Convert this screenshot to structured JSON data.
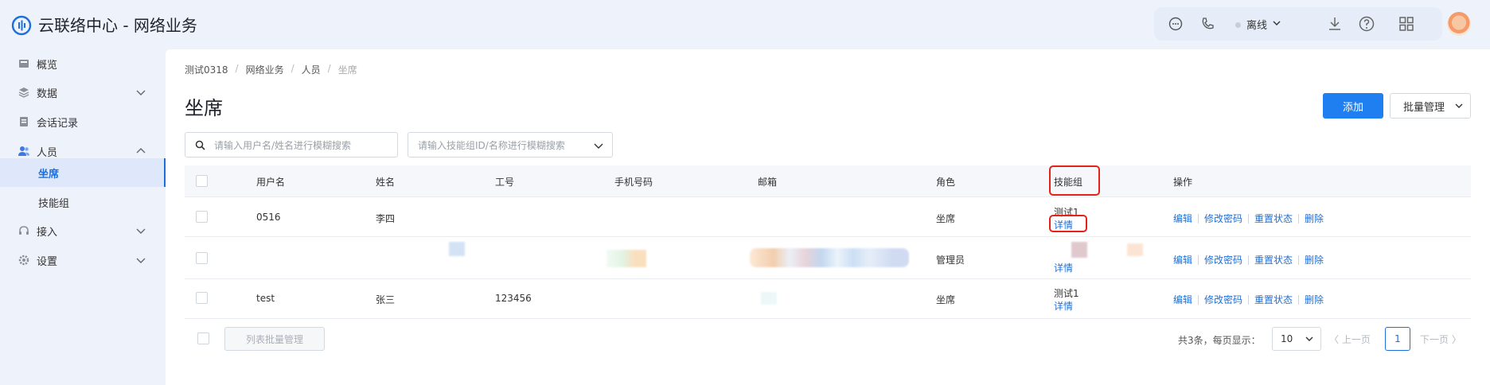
{
  "app": {
    "title": "云联络中心 - 网络业务"
  },
  "header": {
    "status_label": "离线"
  },
  "sidebar": {
    "items": [
      {
        "label": "概览"
      },
      {
        "label": "数据"
      },
      {
        "label": "会话记录"
      },
      {
        "label": "人员"
      },
      {
        "label": "坐席"
      },
      {
        "label": "技能组"
      },
      {
        "label": "接入"
      },
      {
        "label": "设置"
      }
    ]
  },
  "breadcrumb": [
    "测试0318",
    "网络业务",
    "人员",
    "坐席"
  ],
  "page": {
    "title": "坐席"
  },
  "toolbar": {
    "add_label": "添加",
    "batch_label": "批量管理"
  },
  "search": {
    "user_placeholder": "请输入用户名/姓名进行模糊搜索",
    "group_placeholder": "请输入技能组ID/名称进行模糊搜索"
  },
  "table": {
    "columns": [
      "用户名",
      "姓名",
      "工号",
      "手机号码",
      "邮箱",
      "角色",
      "技能组",
      "操作"
    ],
    "rows": [
      {
        "username": "0516",
        "name": "李四",
        "job_no": "",
        "phone": "",
        "email": "",
        "role": "坐席",
        "group": "测试1",
        "group_link": "详情"
      },
      {
        "username": "",
        "name": "",
        "job_no": "",
        "phone": "",
        "email": "",
        "role": "管理员",
        "group": "",
        "group_link": "详情"
      },
      {
        "username": "test",
        "name": "张三",
        "job_no": "123456",
        "phone": "",
        "email": "",
        "role": "坐席",
        "group": "测试1",
        "group_link": "详情"
      }
    ],
    "actions": [
      "编辑",
      "修改密码",
      "重置状态",
      "删除"
    ]
  },
  "footer": {
    "batch_label": "列表批量管理",
    "total_text": "共3条，每页显示：",
    "page_size": "10",
    "prev_label": "上一页",
    "current_page": "1",
    "next_label": "下一页"
  },
  "colors": {
    "primary": "#1f7ff0",
    "highlight": "#e2231a",
    "link": "#1e6fd9"
  }
}
